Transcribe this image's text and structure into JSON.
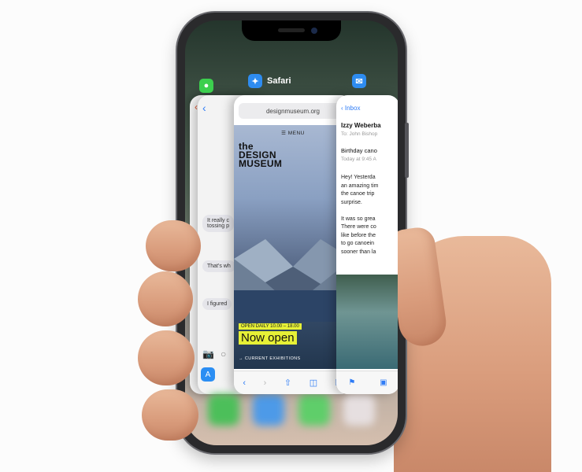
{
  "app_switcher": {
    "safari_label": "Safari",
    "messages": {
      "bubble_1": "It really c",
      "bubble_1b": "tossing p",
      "bubble_2": "That's wh",
      "bubble_3": "I figured"
    },
    "safari": {
      "url": "designmuseum.org",
      "menu_label": "☰  MENU",
      "logo": "the\nDESIGN\nMUSEUM",
      "open_daily": "OPEN DAILY 10.00 – 18.00",
      "now_open": "Now open",
      "exhibitions": "→ CURRENT EXHIBITIONS"
    },
    "mail": {
      "back_label": "‹ Inbox",
      "from": "Izzy Weberba",
      "to": "To: John Bishop",
      "subject": "Birthday cano",
      "date": "Today at 9:45 A",
      "body_lines": [
        "Hey! Yesterda",
        "an amazing tim",
        "the canoe trip",
        "surprise.",
        "",
        "It was so grea",
        "There were co",
        "like before the",
        "to go canoein",
        "sooner than la"
      ]
    }
  },
  "colors": {
    "accent_blue": "#2f7cf6",
    "museum_yellow": "#e6f036"
  }
}
